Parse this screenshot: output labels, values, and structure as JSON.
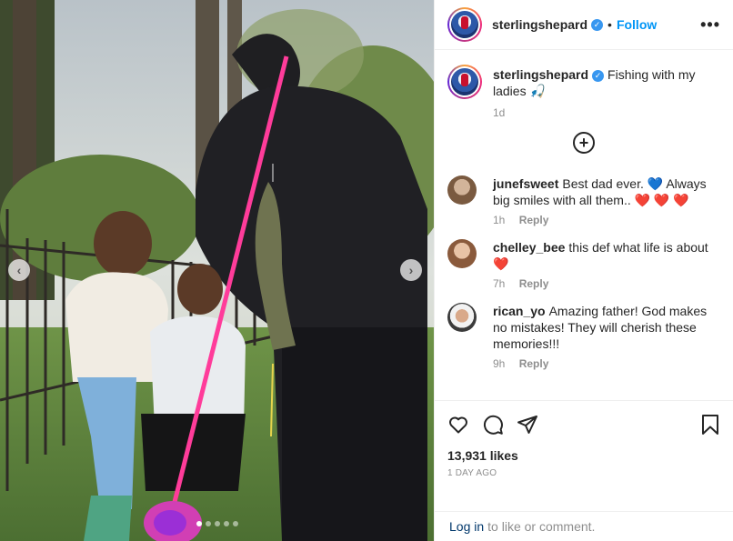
{
  "post": {
    "username": "sterlingshepard",
    "separator": "•",
    "follow_label": "Follow",
    "more_glyph": "•••",
    "verified_glyph": "✓"
  },
  "caption": {
    "username": "sterlingshepard",
    "text": "Fishing with my ladies 🎣",
    "time": "1d"
  },
  "comments": [
    {
      "username": "junefsweet",
      "text_a": "Best dad ever. ",
      "emoji_a": "💙",
      "text_b": " Always big smiles with all them.. ",
      "emoji_b": "❤️ ❤️ ❤️",
      "time": "1h",
      "reply": "Reply"
    },
    {
      "username": "chelley_bee",
      "text_a": "this def what life is about ",
      "emoji_a": "❤️",
      "time": "7h",
      "reply": "Reply"
    },
    {
      "username": "rican_yo",
      "text_a": "Amazing father! God makes no mistakes! They will cherish these memories!!!",
      "time": "9h",
      "reply": "Reply"
    }
  ],
  "load_more_glyph": "+",
  "actions": {
    "icons": [
      "heart-icon",
      "comment-icon",
      "share-icon",
      "bookmark-icon"
    ],
    "likes": "13,931 likes",
    "date": "1 DAY AGO"
  },
  "login": {
    "link": "Log in",
    "text": "to like or comment."
  },
  "carousel": {
    "prev": "‹",
    "next": "›",
    "slides": 5,
    "active_index": 0
  },
  "colors": {
    "accent": "#0095f6",
    "verified": "#3897f0",
    "rod": "#ff3c9a"
  }
}
